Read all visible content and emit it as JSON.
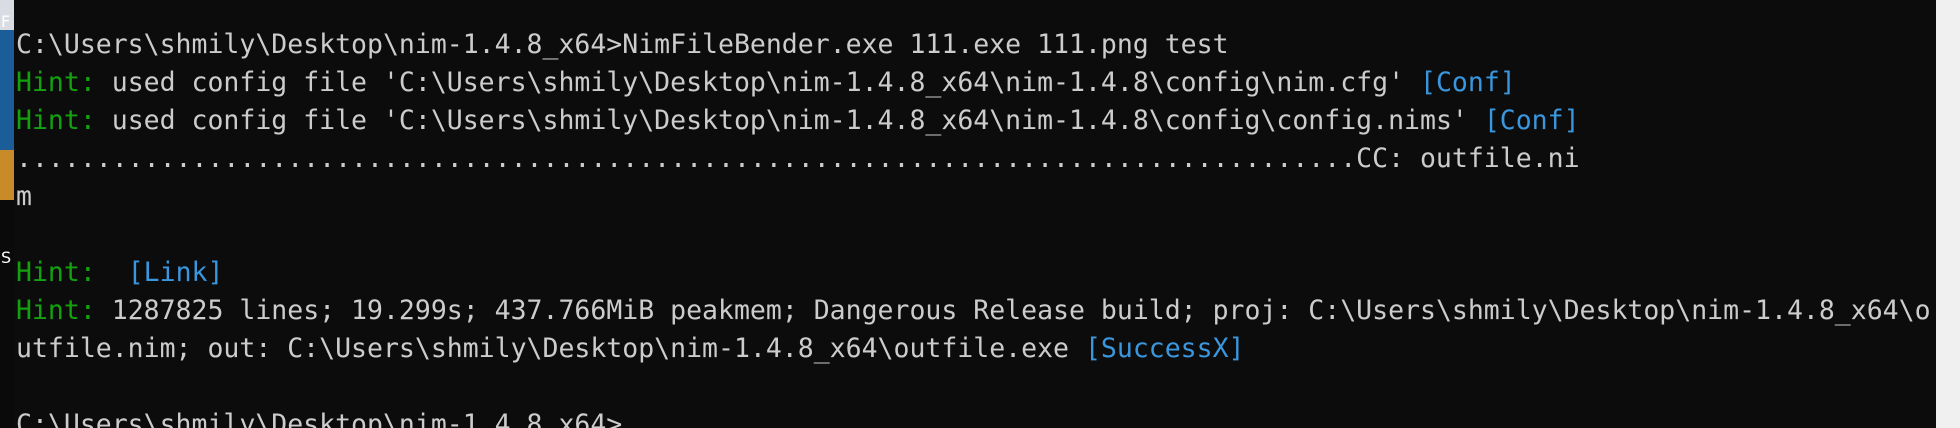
{
  "console": {
    "lines": [
      {
        "text": "C:\\Users\\shmily\\Desktop\\nim-1.4.8_x64>NimFileBender.exe 111.exe 111.png test"
      },
      {
        "hint": "Hint:",
        "text": " used config file 'C:\\Users\\shmily\\Desktop\\nim-1.4.8_x64\\nim-1.4.8\\config\\nim.cfg' ",
        "tag": "[Conf]"
      },
      {
        "hint": "Hint:",
        "text": " used config file 'C:\\Users\\shmily\\Desktop\\nim-1.4.8_x64\\nim-1.4.8\\config\\config.nims' ",
        "tag": "[Conf]"
      },
      {
        "text": "....................................................................................CC: outfile.ni"
      },
      {
        "text": "m"
      },
      {
        "text": ""
      },
      {
        "hint": "Hint:",
        "text": "  ",
        "tag": "[Link]"
      },
      {
        "hint": "Hint:",
        "text": " 1287825 lines; 19.299s; 437.766MiB peakmem; Dangerous Release build; proj: C:\\Users\\shmily\\Desktop\\nim-1.4.8_x64\\o"
      },
      {
        "text": "utfile.nim; out: C:\\Users\\shmily\\Desktop\\nim-1.4.8_x64\\outfile.exe ",
        "tag": "[SuccessX]"
      },
      {
        "text": ""
      },
      {
        "text": "C:\\Users\\shmily\\Desktop\\nim-1.4.8_x64>"
      }
    ]
  },
  "desktop_fragments": {
    "top": "F",
    "middle": "S"
  },
  "colors": {
    "background": "#0c0c0c",
    "text": "#cccccc",
    "hint": "#13a10e",
    "tag": "#3a96dd"
  }
}
